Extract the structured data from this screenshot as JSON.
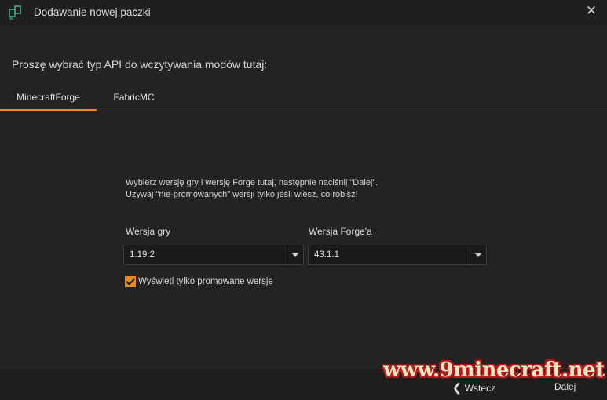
{
  "window": {
    "title": "Dodawanie nowej paczki",
    "close_icon": "close-icon"
  },
  "prompt": "Proszę wybrać typ API do wczytywania modów tutaj:",
  "tabs": [
    {
      "label": "MinecraftForge",
      "active": true
    },
    {
      "label": "FabricMC",
      "active": false
    }
  ],
  "description": {
    "line1": "Wybierz wersję gry i wersję Forge tutaj, następnie naciśnij \"Dalej\".",
    "line2": "Używaj \"nie-promowanych\" wersji tylko jeśli wiesz, co robisz!"
  },
  "game_version": {
    "label": "Wersja gry",
    "value": "1.19.2"
  },
  "forge_version": {
    "label": "Wersja Forge'a",
    "value": "43.1.1"
  },
  "promoted_only": {
    "label": "Wyświetl tylko promowane wersje",
    "checked": true
  },
  "footer": {
    "back_label": "Wstecz",
    "next_label": "Dalej"
  },
  "watermark": "www.9minecraft.net",
  "colors": {
    "accent": "#e58b20",
    "background": "#232323"
  }
}
